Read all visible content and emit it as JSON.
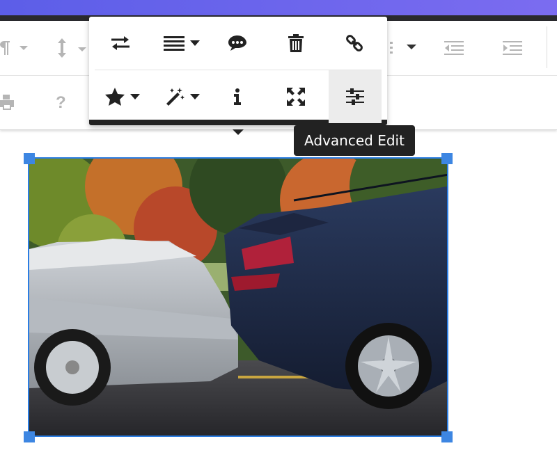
{
  "editor_toolbar": {
    "row1": [
      "paragraph-format-icon",
      "line-height-icon",
      "list-icon",
      "outdent-icon",
      "indent-icon"
    ],
    "row2": [
      "print-icon",
      "help-icon"
    ]
  },
  "image_popup": {
    "row1": [
      {
        "name": "replace-image-button",
        "icon": "swap-arrows-icon"
      },
      {
        "name": "align-image-button",
        "icon": "align-lines-icon",
        "dropdown": true
      },
      {
        "name": "image-caption-button",
        "icon": "comment-icon"
      },
      {
        "name": "remove-image-button",
        "icon": "trash-icon"
      },
      {
        "name": "insert-link-button",
        "icon": "link-icon"
      }
    ],
    "row2": [
      {
        "name": "image-style-button",
        "icon": "star-icon",
        "dropdown": true
      },
      {
        "name": "image-effects-button",
        "icon": "magic-wand-icon",
        "dropdown": true
      },
      {
        "name": "alt-text-button",
        "icon": "info-icon"
      },
      {
        "name": "change-size-button",
        "icon": "expand-icon"
      },
      {
        "name": "advanced-edit-button",
        "icon": "sliders-icon",
        "active": true
      }
    ]
  },
  "tooltip": {
    "text": "Advanced Edit"
  },
  "image": {
    "alt": ""
  },
  "colors": {
    "accent": "#3d86e2",
    "header": "#6a63ee",
    "tooltip_bg": "#222222"
  }
}
